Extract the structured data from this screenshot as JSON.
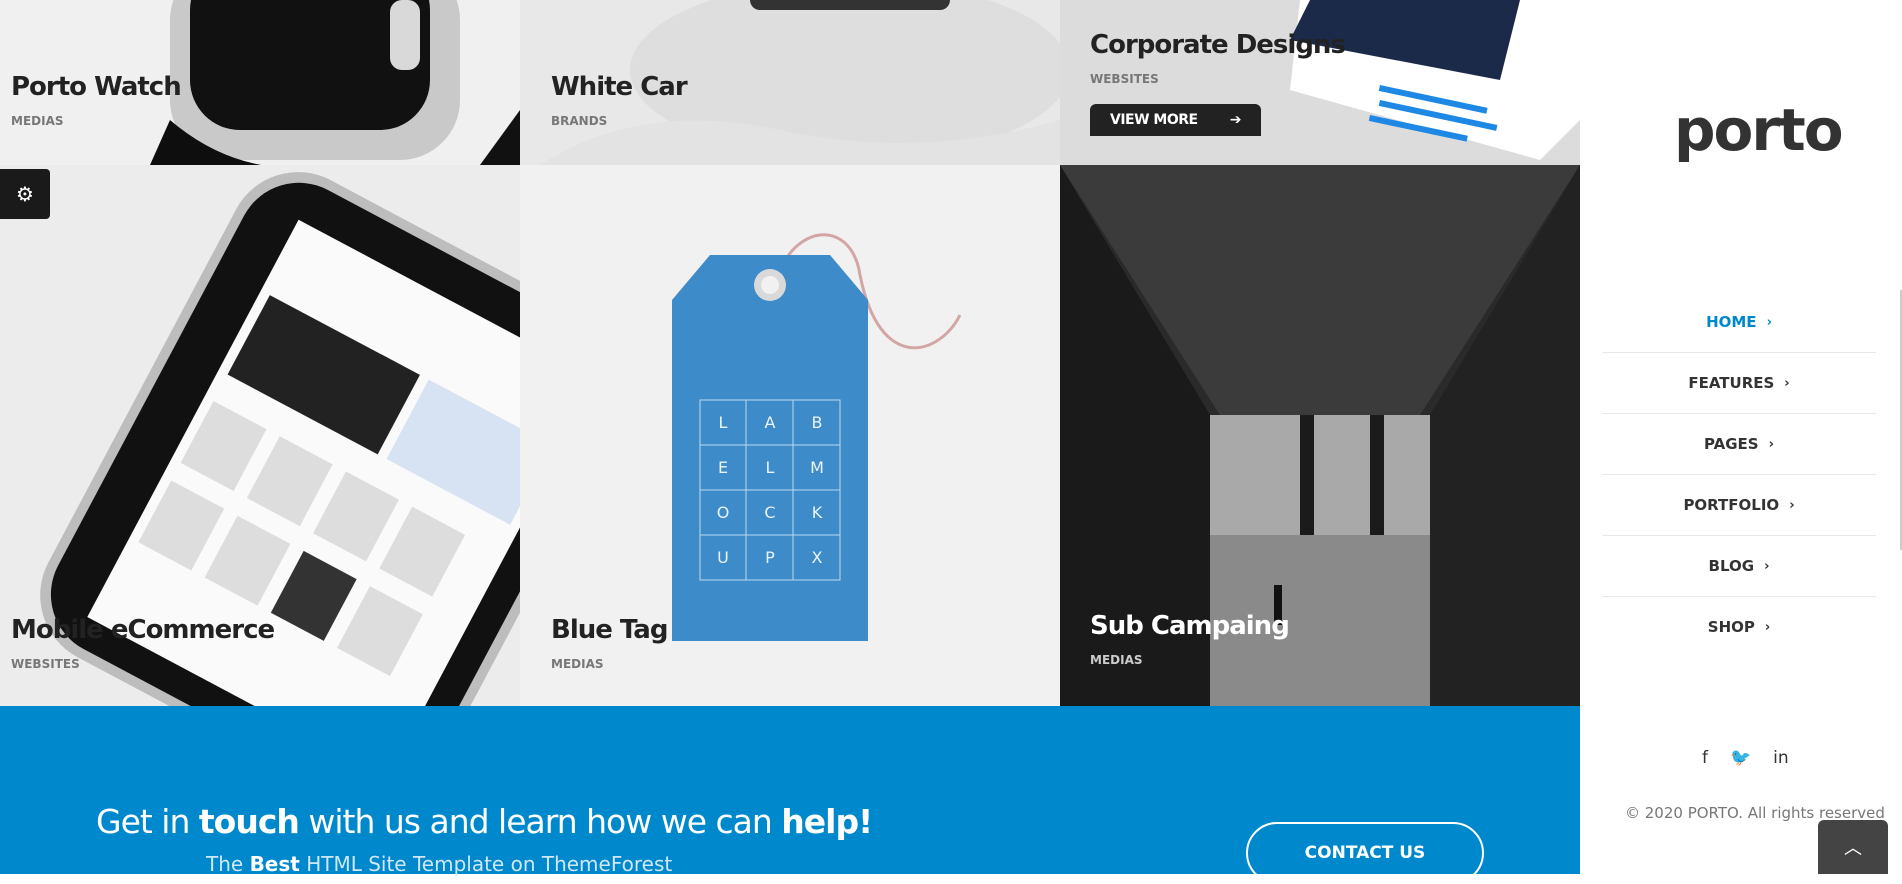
{
  "portfolio": [
    {
      "title": "Porto Watch",
      "category": "MEDIAS"
    },
    {
      "title": "White Car",
      "category": "BRANDS"
    },
    {
      "title": "Corporate Designs",
      "category": "WEBSITES",
      "button": "VIEW MORE"
    },
    {
      "title": "Mobile eCommerce",
      "category": "WEBSITES"
    },
    {
      "title": "Blue Tag",
      "category": "MEDIAS"
    },
    {
      "title": "Sub Campaing",
      "category": "MEDIAS"
    }
  ],
  "tag_letters": [
    "L",
    "A",
    "B",
    "E",
    "L",
    "M",
    "O",
    "C",
    "K",
    "U",
    "P",
    "X"
  ],
  "sidebar": {
    "logo": "porto",
    "nav": [
      {
        "label": "HOME",
        "active": true
      },
      {
        "label": "FEATURES"
      },
      {
        "label": "PAGES"
      },
      {
        "label": "PORTFOLIO"
      },
      {
        "label": "BLOG"
      },
      {
        "label": "SHOP"
      }
    ],
    "social": [
      "facebook-icon",
      "twitter-icon",
      "linkedin-icon"
    ],
    "copyright": "© 2020 PORTO. All rights reserved"
  },
  "cta": {
    "head_1": "Get in ",
    "head_2": "touch",
    "head_3": " with us and learn how we can ",
    "head_4": "help!",
    "sub_1": "The ",
    "sub_2": "Best",
    "sub_3": " HTML Site Template on ThemeForest",
    "button": "CONTACT US"
  },
  "colors": {
    "accent": "#0088cc",
    "dark": "#222222"
  }
}
